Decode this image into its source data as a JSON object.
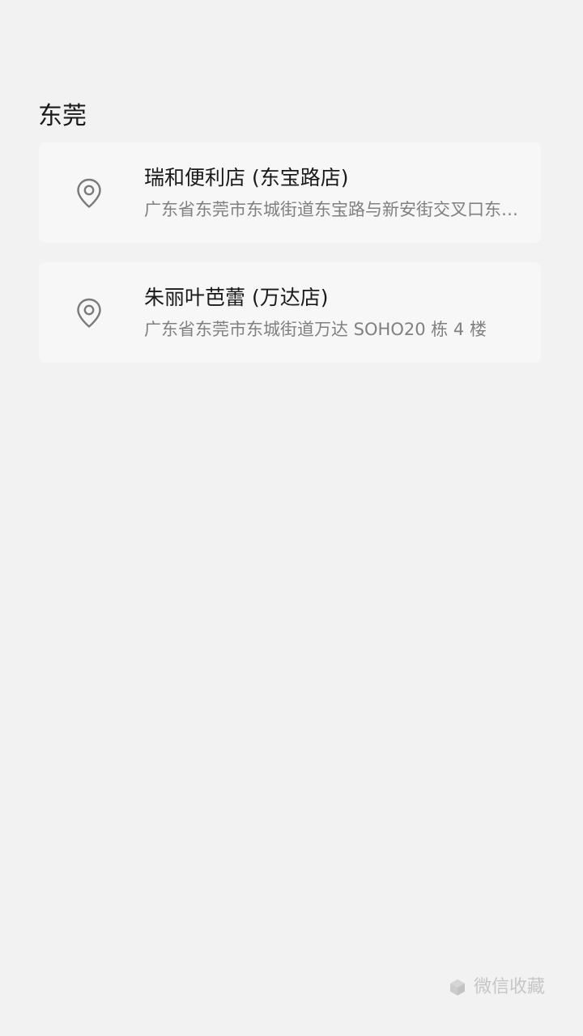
{
  "section": {
    "title": "东莞"
  },
  "stores": [
    {
      "name": "瑞和便利店 (东宝路店)",
      "address": "广东省东莞市东城街道东宝路与新安街交叉口东北角",
      "icon": "location-pin-icon"
    },
    {
      "name": "朱丽叶芭蕾 (万达店)",
      "address": "广东省东莞市东城街道万达 SOHO20 栋 4 楼",
      "icon": "location-pin-icon"
    }
  ],
  "footer": {
    "label": "微信收藏",
    "icon": "cube-icon"
  },
  "colors": {
    "background": "#f2f2f2",
    "card": "#f7f7f7",
    "primary_text": "#191919",
    "secondary_text": "#808080",
    "footer_text": "#c6c6c6"
  }
}
